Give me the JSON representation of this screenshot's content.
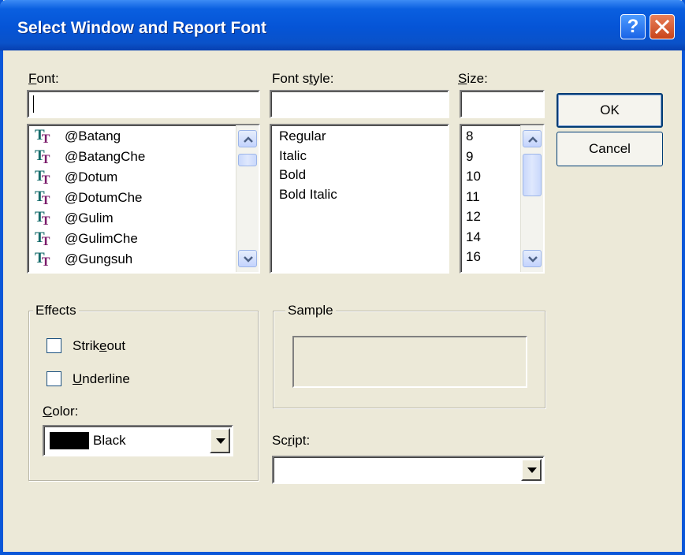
{
  "window": {
    "title": "Select Window and Report Font",
    "help_glyph": "?"
  },
  "font": {
    "label": "Font:",
    "value": "",
    "items": [
      "@Batang",
      "@BatangChe",
      "@Dotum",
      "@DotumChe",
      "@Gulim",
      "@GulimChe",
      "@Gungsuh"
    ]
  },
  "font_style": {
    "label": "Font style:",
    "value": "",
    "items": [
      "Regular",
      "Italic",
      "Bold",
      "Bold Italic"
    ]
  },
  "size": {
    "label": "Size:",
    "value": "",
    "items": [
      "8",
      "9",
      "10",
      "11",
      "12",
      "14",
      "16"
    ]
  },
  "buttons": {
    "ok": "OK",
    "cancel": "Cancel"
  },
  "effects": {
    "label": "Effects",
    "strikeout": {
      "label": "Strikeout",
      "checked": false
    },
    "underline": {
      "label": "Underline",
      "checked": false
    },
    "color_label": "Color:",
    "color_value": "Black",
    "color_swatch": "#000000"
  },
  "sample": {
    "label": "Sample"
  },
  "script": {
    "label": "Script:",
    "value": ""
  },
  "colors": {
    "title_bar": "#0554d6",
    "face": "#ece9d8",
    "font_icon_teal": "#156b6b",
    "font_icon_purple": "#7a1a6a"
  },
  "icons": {
    "help": "help-icon",
    "close": "close-icon",
    "font_type": "truetype-icon"
  }
}
